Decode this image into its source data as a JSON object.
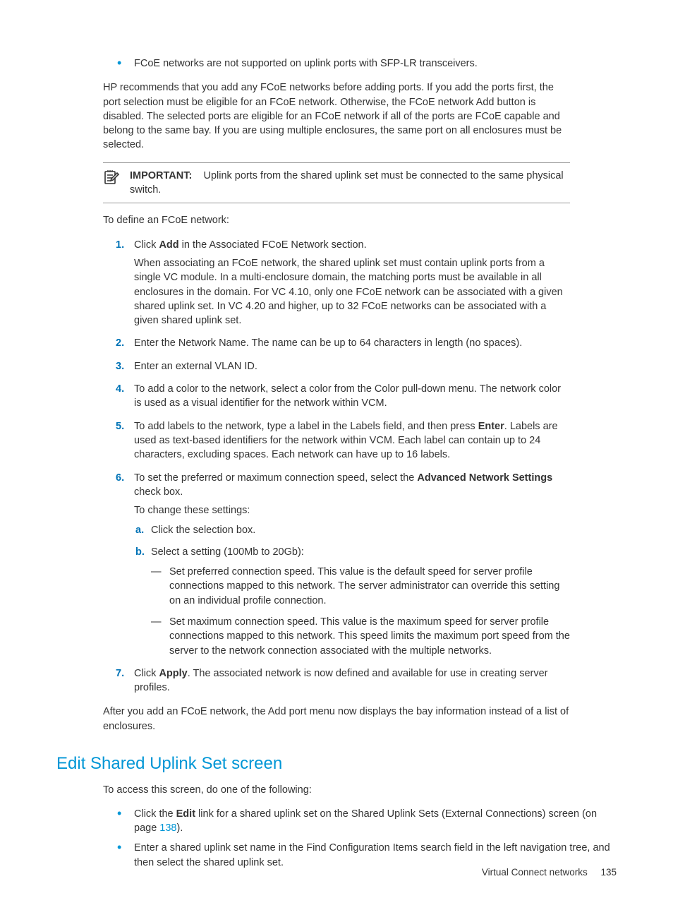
{
  "bullets_top": [
    "FCoE networks are not supported on uplink ports with SFP-LR transceivers."
  ],
  "para1": "HP recommends that you add any FCoE networks before adding ports. If you add the ports first, the port selection must be eligible for an FCoE network. Otherwise, the FCoE network Add button is disabled. The selected ports are eligible for an FCoE network if all of the ports are FCoE capable and belong to the same bay. If you are using multiple enclosures, the same port on all enclosures must be selected.",
  "callout_label": "IMPORTANT:",
  "callout_text": "Uplink ports from the shared uplink set must be connected to the same physical switch.",
  "para2": "To define an FCoE network:",
  "step1_pre": "Click ",
  "step1_bold": "Add",
  "step1_post": " in the Associated FCoE Network section.",
  "step1_sub": "When associating an FCoE network, the shared uplink set must contain uplink ports from a single VC module. In a multi-enclosure domain, the matching ports must be available in all enclosures in the domain. For VC 4.10, only one FCoE network can be associated with a given shared uplink set. In VC 4.20 and higher, up to 32 FCoE networks can be associated with a given shared uplink set.",
  "step2": "Enter the Network Name. The name can be up to 64 characters in length (no spaces).",
  "step3": "Enter an external VLAN ID.",
  "step4": "To add a color to the network, select a color from the Color pull-down menu. The network color is used as a visual identifier for the network within VCM.",
  "step5_pre": "To add labels to the network, type a label in the Labels field, and then press ",
  "step5_bold": "Enter",
  "step5_post": ". Labels are used as text-based identifiers for the network within VCM. Each label can contain up to 24 characters, excluding spaces. Each network can have up to 16 labels.",
  "step6_pre": "To set the preferred or maximum connection speed, select the ",
  "step6_bold": "Advanced Network Settings",
  "step6_post": " check box.",
  "step6_sub": "To change these settings:",
  "step6a": "Click the selection box.",
  "step6b": "Select a setting (100Mb to 20Gb):",
  "step6b_d1": "Set preferred connection speed. This value is the default speed for server profile connections mapped to this network. The server administrator can override this setting on an individual profile connection.",
  "step6b_d2": "Set maximum connection speed. This value is the maximum speed for server profile connections mapped to this network. This speed limits the maximum port speed from the server to the network connection associated with the multiple networks.",
  "step7_pre": "Click ",
  "step7_bold": "Apply",
  "step7_post": ". The associated network is now defined and available for use in creating server profiles.",
  "para3": "After you add an FCoE network, the Add port menu now displays the bay information instead of a list of enclosures.",
  "heading": "Edit Shared Uplink Set screen",
  "para4": "To access this screen, do one of the following:",
  "b1_pre": "Click the ",
  "b1_bold": "Edit",
  "b1_post": " link for a shared uplink set on the Shared Uplink Sets (External Connections) screen (on page ",
  "b1_link": "138",
  "b1_tail": ").",
  "b2": "Enter a shared uplink set name in the Find Configuration Items search field in the left navigation tree, and then select the shared uplink set.",
  "footer_text": "Virtual Connect networks",
  "footer_page": "135"
}
